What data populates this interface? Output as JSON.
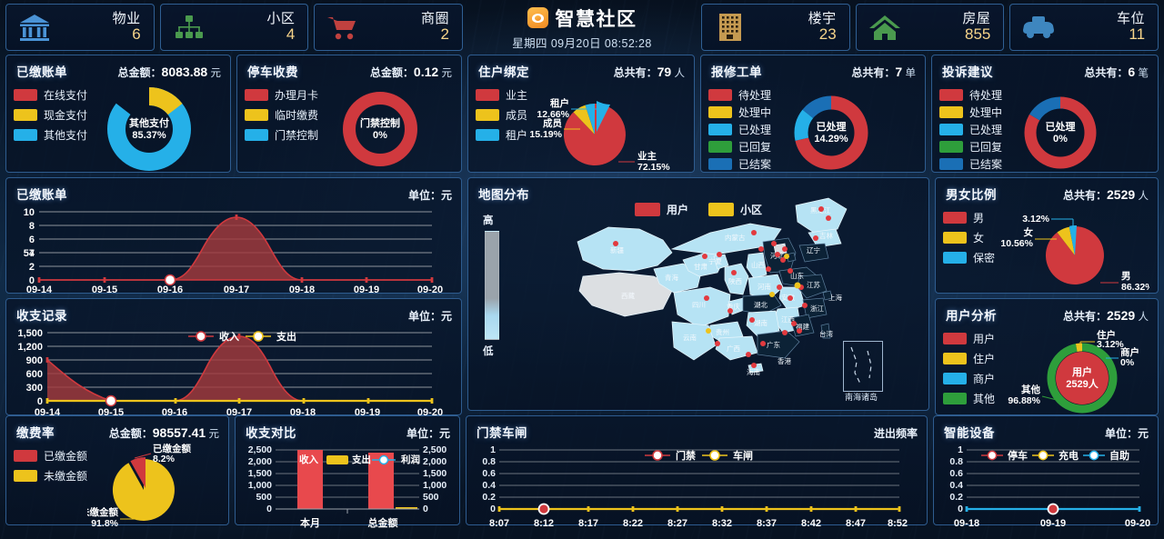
{
  "header": {
    "brand_title": "智慧社区",
    "brand_datetime": "星期四 09月20日 08:52:28",
    "left_cards": [
      {
        "icon": "bank-icon",
        "label": "物业",
        "value": "6"
      },
      {
        "icon": "org-tree-icon",
        "label": "小区",
        "value": "4"
      },
      {
        "icon": "shopping-cart-icon",
        "label": "商圈",
        "value": "2"
      }
    ],
    "right_cards": [
      {
        "icon": "building-icon",
        "label": "楼宇",
        "value": "23"
      },
      {
        "icon": "house-icon",
        "label": "房屋",
        "value": "855"
      },
      {
        "icon": "car-icon",
        "label": "车位",
        "value": "11"
      }
    ]
  },
  "colors": {
    "red": "#d0393e",
    "yellow": "#edc31c",
    "cyan": "#25b0e8",
    "green": "#2e9e3b",
    "blue": "#1a6fb5",
    "panel_border": "#2e5c8f",
    "accent_gold": "#f7d58a"
  },
  "panels": {
    "paid_bill_donut": {
      "title": "已缴账单",
      "meta_label": "总金额：",
      "meta_value": "8083.88",
      "meta_unit": "元",
      "legend": [
        "在线支付",
        "现金支付",
        "其他支付"
      ],
      "center_label": "其他支付",
      "center_value": "85.37%"
    },
    "parking_fee_donut": {
      "title": "停车收费",
      "meta_label": "总金额：",
      "meta_value": "0.12",
      "meta_unit": "元",
      "legend": [
        "办理月卡",
        "临时缴费",
        "门禁控制"
      ],
      "center_label": "门禁控制",
      "center_value": "0%"
    },
    "resident_binding_pie": {
      "title": "住户绑定",
      "meta_label": "总共有：",
      "meta_value": "79",
      "meta_unit": "人",
      "legend": [
        "业主",
        "成员",
        "租户"
      ],
      "labels": [
        {
          "name": "租户",
          "value": "12.66%"
        },
        {
          "name": "成员",
          "value": "15.19%"
        },
        {
          "name": "业主",
          "value": "72.15%"
        }
      ]
    },
    "repair_orders_donut": {
      "title": "报修工单",
      "meta_label": "总共有：",
      "meta_value": "7",
      "meta_unit": "单",
      "legend": [
        "待处理",
        "处理中",
        "已处理",
        "已回复",
        "已结案"
      ],
      "center_label": "已处理",
      "center_value": "14.29%"
    },
    "complaints_donut": {
      "title": "投诉建议",
      "meta_label": "总共有：",
      "meta_value": "6",
      "meta_unit": "笔",
      "legend": [
        "待处理",
        "处理中",
        "已处理",
        "已回复",
        "已结案"
      ],
      "center_label": "已处理",
      "center_value": "0%"
    },
    "paid_bill_line": {
      "title": "已缴账单",
      "meta": "单位：元"
    },
    "income_expense_line": {
      "title": "收支记录",
      "meta": "单位：元"
    },
    "map": {
      "title": "地图分布",
      "legend": [
        "用户",
        "小区"
      ],
      "scale_high": "高",
      "scale_low": "低",
      "inset_label": "南海诸岛",
      "provinces": [
        "新疆",
        "西藏",
        "青海",
        "甘肃",
        "内蒙古",
        "宁夏",
        "陕西",
        "四川",
        "重庆",
        "云南",
        "贵州",
        "广西",
        "广东",
        "湖南",
        "湖北",
        "河南",
        "山西",
        "河北",
        "山东",
        "江西",
        "福建",
        "台湾",
        "浙江",
        "江苏",
        "上海",
        "安徽",
        "黑龙江",
        "吉林",
        "辽宁",
        "海南",
        "香港"
      ]
    },
    "gender_pie": {
      "title": "男女比例",
      "meta_label": "总共有：",
      "meta_value": "2529",
      "meta_unit": "人",
      "legend": [
        "男",
        "女",
        "保密"
      ],
      "labels": [
        {
          "name": "",
          "value": "3.12%"
        },
        {
          "name": "女",
          "value": "10.56%"
        },
        {
          "name": "男",
          "value": "86.32%"
        }
      ]
    },
    "user_analysis_donut": {
      "title": "用户分析",
      "meta_label": "总共有：",
      "meta_value": "2529",
      "meta_unit": "人",
      "legend": [
        "用户",
        "住户",
        "商户",
        "其他"
      ],
      "center_label": "用户",
      "center_value": "2529人",
      "labels": [
        {
          "name": "住户",
          "value": "3.12%"
        },
        {
          "name": "商户",
          "value": "0%"
        },
        {
          "name": "其他",
          "value": "96.88%"
        }
      ]
    },
    "payment_rate_pie": {
      "title": "缴费率",
      "meta_label": "总金额：",
      "meta_value": "98557.41",
      "meta_unit": "元",
      "legend": [
        "已缴金额",
        "未缴金额"
      ],
      "labels": [
        {
          "name": "已缴金额",
          "value": "8.2%"
        },
        {
          "name": "未缴金额",
          "value": "91.8%"
        }
      ]
    },
    "income_expense_bar": {
      "title": "收支对比",
      "meta": "单位：元"
    },
    "gate_barrier_line": {
      "title": "门禁车闸",
      "meta": "进出频率"
    },
    "smart_device_line": {
      "title": "智能设备",
      "meta": "单位：元"
    }
  },
  "chart_data": [
    {
      "id": "paid_bill_line",
      "type": "area",
      "title": "已缴账单",
      "ylabel": "元",
      "x": [
        "09-14",
        "09-15",
        "09-16",
        "09-17",
        "09-18",
        "09-19",
        "09-20"
      ],
      "series": [
        {
          "name": "已缴账单",
          "values": [
            0,
            0,
            0,
            9.3,
            0,
            0,
            0
          ],
          "color": "#d0393e"
        }
      ],
      "yticks": [
        0,
        2,
        4,
        6,
        8,
        10
      ],
      "ylim": [
        0,
        10
      ],
      "grid": true,
      "highlight_point": "09-16"
    },
    {
      "id": "income_expense_line",
      "type": "area",
      "title": "收支记录",
      "ylabel": "元",
      "x": [
        "09-14",
        "09-15",
        "09-16",
        "09-17",
        "09-18",
        "09-19",
        "09-20"
      ],
      "series": [
        {
          "name": "收入",
          "values": [
            880,
            0,
            0,
            1300,
            0,
            0,
            0
          ],
          "color": "#d0393e"
        },
        {
          "name": "支出",
          "values": [
            0,
            0,
            0,
            0,
            0,
            0,
            0
          ],
          "color": "#edc31c"
        }
      ],
      "yticks": [
        0,
        300,
        600,
        900,
        1200,
        1500
      ],
      "yticklabels": [
        "0",
        "300",
        "600",
        "900",
        "1,200",
        "1,500"
      ],
      "ylim": [
        0,
        1500
      ],
      "grid": true,
      "legend": [
        "收入",
        "支出"
      ],
      "highlight_point": "09-15"
    },
    {
      "id": "income_expense_bar",
      "type": "bar",
      "title": "收支对比",
      "ylabel": "元",
      "categories": [
        "本月",
        "总金额"
      ],
      "series": [
        {
          "name": "收入",
          "values": [
            2500,
            2400
          ],
          "color": "#e8494d"
        },
        {
          "name": "支出",
          "values": [
            0,
            0
          ],
          "color": "#edc31c"
        },
        {
          "name": "利润",
          "values": [
            0,
            40
          ],
          "color": "#25b0e8"
        }
      ],
      "yticks": [
        0,
        500,
        1000,
        1500,
        2000,
        2500
      ],
      "yticklabels": [
        "0",
        "500",
        "1,000",
        "1,500",
        "2,000",
        "2,500"
      ],
      "ylim": [
        0,
        2500
      ],
      "legend": [
        "收入",
        "支出",
        "利润"
      ],
      "dual_axis": true
    },
    {
      "id": "gate_barrier_line",
      "type": "line",
      "title": "门禁车闸",
      "ylabel": "进出频率",
      "x": [
        "8:07",
        "8:12",
        "8:17",
        "8:22",
        "8:27",
        "8:32",
        "8:37",
        "8:42",
        "8:47",
        "8:52"
      ],
      "series": [
        {
          "name": "门禁",
          "values": [
            0,
            0,
            0,
            0,
            0,
            0,
            0,
            0,
            0,
            0
          ],
          "color": "#d0393e"
        },
        {
          "name": "车闸",
          "values": [
            0,
            0,
            0,
            0,
            0,
            0,
            0,
            0,
            0,
            0
          ],
          "color": "#edc31c"
        }
      ],
      "yticks": [
        0,
        0.2,
        0.4,
        0.6,
        0.8,
        1
      ],
      "ylim": [
        0,
        1
      ],
      "grid": true,
      "legend": [
        "门禁",
        "车闸"
      ],
      "highlight_point": "8:12"
    },
    {
      "id": "smart_device_line",
      "type": "line",
      "title": "智能设备",
      "ylabel": "元",
      "x": [
        "09-18",
        "09-19",
        "09-20"
      ],
      "series": [
        {
          "name": "停车",
          "values": [
            0,
            0,
            0
          ],
          "color": "#d0393e"
        },
        {
          "name": "充电",
          "values": [
            0,
            0,
            0
          ],
          "color": "#edc31c"
        },
        {
          "name": "自助",
          "values": [
            0,
            0,
            0
          ],
          "color": "#25b0e8"
        }
      ],
      "yticks": [
        0,
        0.2,
        0.4,
        0.6,
        0.8,
        1
      ],
      "ylim": [
        0,
        1
      ],
      "grid": true,
      "legend": [
        "停车",
        "充电",
        "自助"
      ],
      "highlight_point": "09-19"
    },
    {
      "id": "paid_bill_donut",
      "type": "pie",
      "title": "已缴账单",
      "labels": [
        "在线支付",
        "现金支付",
        "其他支付"
      ],
      "values": [
        0,
        14.63,
        85.37
      ],
      "colors": [
        "#d0393e",
        "#edc31c",
        "#25b0e8"
      ]
    },
    {
      "id": "parking_fee_donut",
      "type": "pie",
      "title": "停车收费",
      "labels": [
        "办理月卡",
        "临时缴费",
        "门禁控制"
      ],
      "values": [
        100,
        0,
        0
      ],
      "colors": [
        "#d0393e",
        "#edc31c",
        "#25b0e8"
      ]
    },
    {
      "id": "resident_binding_pie",
      "type": "pie",
      "title": "住户绑定",
      "labels": [
        "业主",
        "成员",
        "租户"
      ],
      "values": [
        72.15,
        15.19,
        12.66
      ],
      "colors": [
        "#d0393e",
        "#edc31c",
        "#25b0e8"
      ]
    },
    {
      "id": "repair_orders_donut",
      "type": "pie",
      "title": "报修工单",
      "labels": [
        "待处理",
        "处理中",
        "已处理",
        "已回复",
        "已结案"
      ],
      "values": [
        71.42,
        0,
        14.29,
        0,
        14.29
      ],
      "colors": [
        "#d0393e",
        "#edc31c",
        "#25b0e8",
        "#2e9e3b",
        "#1a6fb5"
      ]
    },
    {
      "id": "complaints_donut",
      "type": "pie",
      "title": "投诉建议",
      "labels": [
        "待处理",
        "处理中",
        "已处理",
        "已回复",
        "已结案"
      ],
      "values": [
        83.3,
        0,
        0,
        0,
        16.7
      ],
      "colors": [
        "#d0393e",
        "#edc31c",
        "#25b0e8",
        "#2e9e3b",
        "#1a6fb5"
      ]
    },
    {
      "id": "gender_pie",
      "type": "pie",
      "title": "男女比例",
      "labels": [
        "男",
        "女",
        "保密"
      ],
      "values": [
        86.32,
        10.56,
        3.12
      ],
      "colors": [
        "#d0393e",
        "#edc31c",
        "#25b0e8"
      ]
    },
    {
      "id": "user_analysis_donut",
      "type": "pie",
      "title": "用户分析",
      "labels": [
        "用户",
        "住户",
        "商户",
        "其他"
      ],
      "values": [
        0,
        3.12,
        0,
        96.88
      ],
      "colors": [
        "#d0393e",
        "#edc31c",
        "#25b0e8",
        "#2e9e3b"
      ]
    },
    {
      "id": "payment_rate_pie",
      "type": "pie",
      "title": "缴费率",
      "labels": [
        "已缴金额",
        "未缴金额"
      ],
      "values": [
        8.2,
        91.8
      ],
      "colors": [
        "#d0393e",
        "#edc31c"
      ]
    }
  ]
}
